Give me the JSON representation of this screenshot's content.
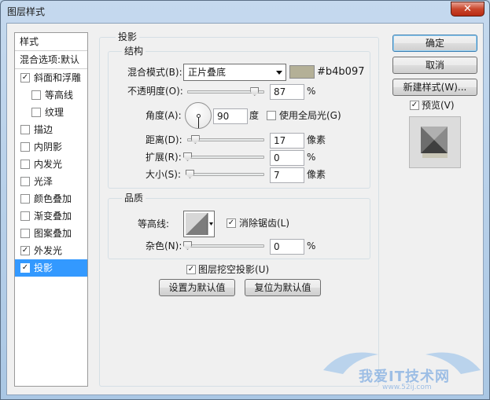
{
  "window": {
    "title": "图层样式",
    "close_glyph": "✕"
  },
  "sidebar": {
    "header": "样式",
    "blend_options": "混合选项:默认",
    "items": [
      {
        "label": "斜面和浮雕",
        "checked": true,
        "indent": false
      },
      {
        "label": "等高线",
        "checked": false,
        "indent": true
      },
      {
        "label": "纹理",
        "checked": false,
        "indent": true
      },
      {
        "label": "描边",
        "checked": false,
        "indent": false
      },
      {
        "label": "内阴影",
        "checked": false,
        "indent": false
      },
      {
        "label": "内发光",
        "checked": false,
        "indent": false
      },
      {
        "label": "光泽",
        "checked": false,
        "indent": false
      },
      {
        "label": "颜色叠加",
        "checked": false,
        "indent": false
      },
      {
        "label": "渐变叠加",
        "checked": false,
        "indent": false
      },
      {
        "label": "图案叠加",
        "checked": false,
        "indent": false
      },
      {
        "label": "外发光",
        "checked": true,
        "indent": false
      },
      {
        "label": "投影",
        "checked": true,
        "indent": false,
        "selected": true
      }
    ]
  },
  "drop_shadow": {
    "title": "投影",
    "structure": {
      "title": "结构",
      "blend_mode_label": "混合模式(B):",
      "blend_mode_value": "正片叠底",
      "color_hex": "#b4b097",
      "color_text": "#b4b097",
      "opacity_label": "不透明度(O):",
      "opacity_value": "87",
      "opacity_unit": "%",
      "opacity_fraction": 0.87,
      "angle_label": "角度(A):",
      "angle_value": "90",
      "angle_unit": "度",
      "global_light_label": "使用全局光(G)",
      "global_light_checked": false,
      "distance_label": "距离(D):",
      "distance_value": "17",
      "distance_unit": "像素",
      "distance_fraction": 0.1,
      "spread_label": "扩展(R):",
      "spread_value": "0",
      "spread_unit": "%",
      "spread_fraction": 0,
      "size_label": "大小(S):",
      "size_value": "7",
      "size_unit": "像素",
      "size_fraction": 0.03
    },
    "quality": {
      "title": "品质",
      "contour_label": "等高线:",
      "anti_alias_label": "消除锯齿(L)",
      "anti_alias_checked": true,
      "noise_label": "杂色(N):",
      "noise_value": "0",
      "noise_unit": "%",
      "noise_fraction": 0
    },
    "knockout_label": "图层挖空投影(U)",
    "knockout_checked": true,
    "make_default": "设置为默认值",
    "reset_default": "复位为默认值"
  },
  "actions": {
    "ok": "确定",
    "cancel": "取消",
    "new_style": "新建样式(W)...",
    "preview_label": "预览(V)",
    "preview_checked": true
  },
  "watermark": {
    "text": "我爱IT技术网",
    "url": "www.52ij.com"
  }
}
